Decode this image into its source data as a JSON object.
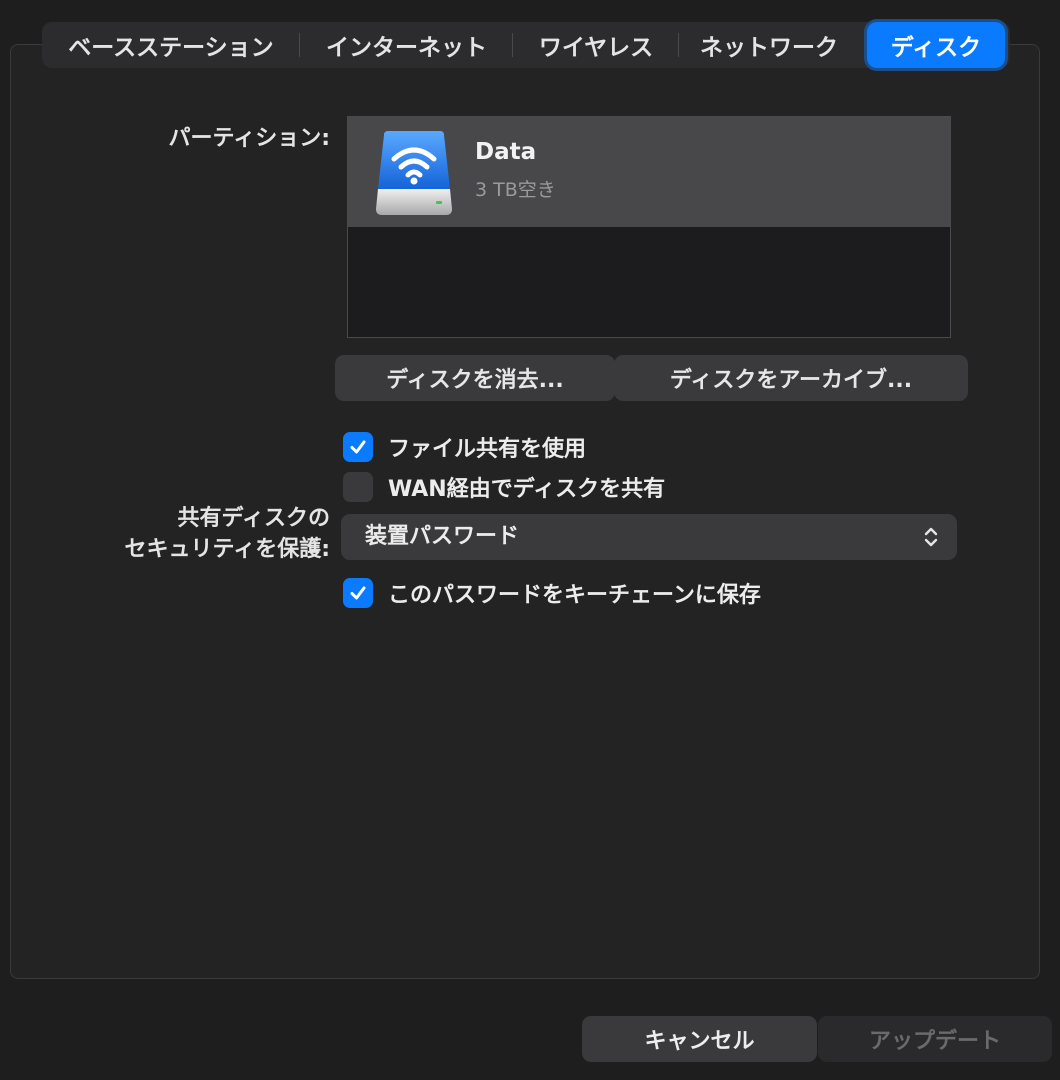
{
  "tabs": [
    {
      "label": "ベースステーション"
    },
    {
      "label": "インターネット"
    },
    {
      "label": "ワイヤレス"
    },
    {
      "label": "ネットワーク"
    },
    {
      "label": "ディスク",
      "active": true
    }
  ],
  "partition": {
    "label": "パーティション:",
    "items": [
      {
        "name": "Data",
        "free": "3 TB空き"
      }
    ]
  },
  "buttons": {
    "erase": "ディスクを消去...",
    "archive": "ディスクをアーカイブ..."
  },
  "options": {
    "file_sharing": {
      "label": "ファイル共有を使用",
      "checked": true
    },
    "wan_sharing": {
      "label": "WAN経由でディスクを共有",
      "checked": false
    },
    "security_label_line1": "共有ディスクの",
    "security_label_line2": "セキュリティを保護:",
    "security_value": "装置パスワード",
    "keychain": {
      "label": "このパスワードをキーチェーンに保存",
      "checked": true
    }
  },
  "footer": {
    "cancel": "キャンセル",
    "update": "アップデート"
  },
  "colors": {
    "accent": "#0a7bff",
    "background": "#1e1e1f",
    "control": "#3a3a3c"
  }
}
